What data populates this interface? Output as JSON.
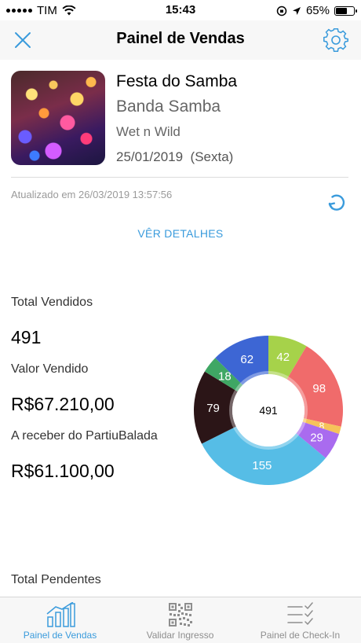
{
  "status_bar": {
    "carrier": "TIM",
    "time": "15:43",
    "battery": "65%",
    "battery_level": 0.65
  },
  "header": {
    "title": "Painel de Vendas",
    "close_icon": "close-icon",
    "settings_icon": "gear-icon"
  },
  "event": {
    "name": "Festa do Samba",
    "artist": "Banda Samba",
    "venue": "Wet n Wild",
    "date": "25/01/2019",
    "weekday": "(Sexta)"
  },
  "updated_text": "Atualizado em 26/03/2019 13:57:56",
  "details_link": "VÊR DETALHES",
  "stats": {
    "total_sold_label": "Total Vendidos",
    "total_sold_value": "491",
    "amount_sold_label": "Valor Vendido",
    "amount_sold_value": "R$67.210,00",
    "receivable_label": "A receber do PartiuBalada",
    "receivable_value": "R$61.100,00"
  },
  "chart_data": {
    "type": "pie",
    "center_label": "491",
    "values": [
      42,
      98,
      8,
      29,
      155,
      79,
      18,
      62
    ],
    "colors": [
      "#a6d24a",
      "#f06b6b",
      "#f6c35a",
      "#a96bef",
      "#56bde6",
      "#2b1517",
      "#3fa764",
      "#3d66d4"
    ]
  },
  "pending_label": "Total Pendentes",
  "tabs": [
    {
      "label": "Painel de Vendas",
      "icon": "bar-chart-icon",
      "active": true
    },
    {
      "label": "Validar Ingresso",
      "icon": "qr-code-icon",
      "active": false
    },
    {
      "label": "Painel de Check-In",
      "icon": "checklist-icon",
      "active": false
    }
  ]
}
